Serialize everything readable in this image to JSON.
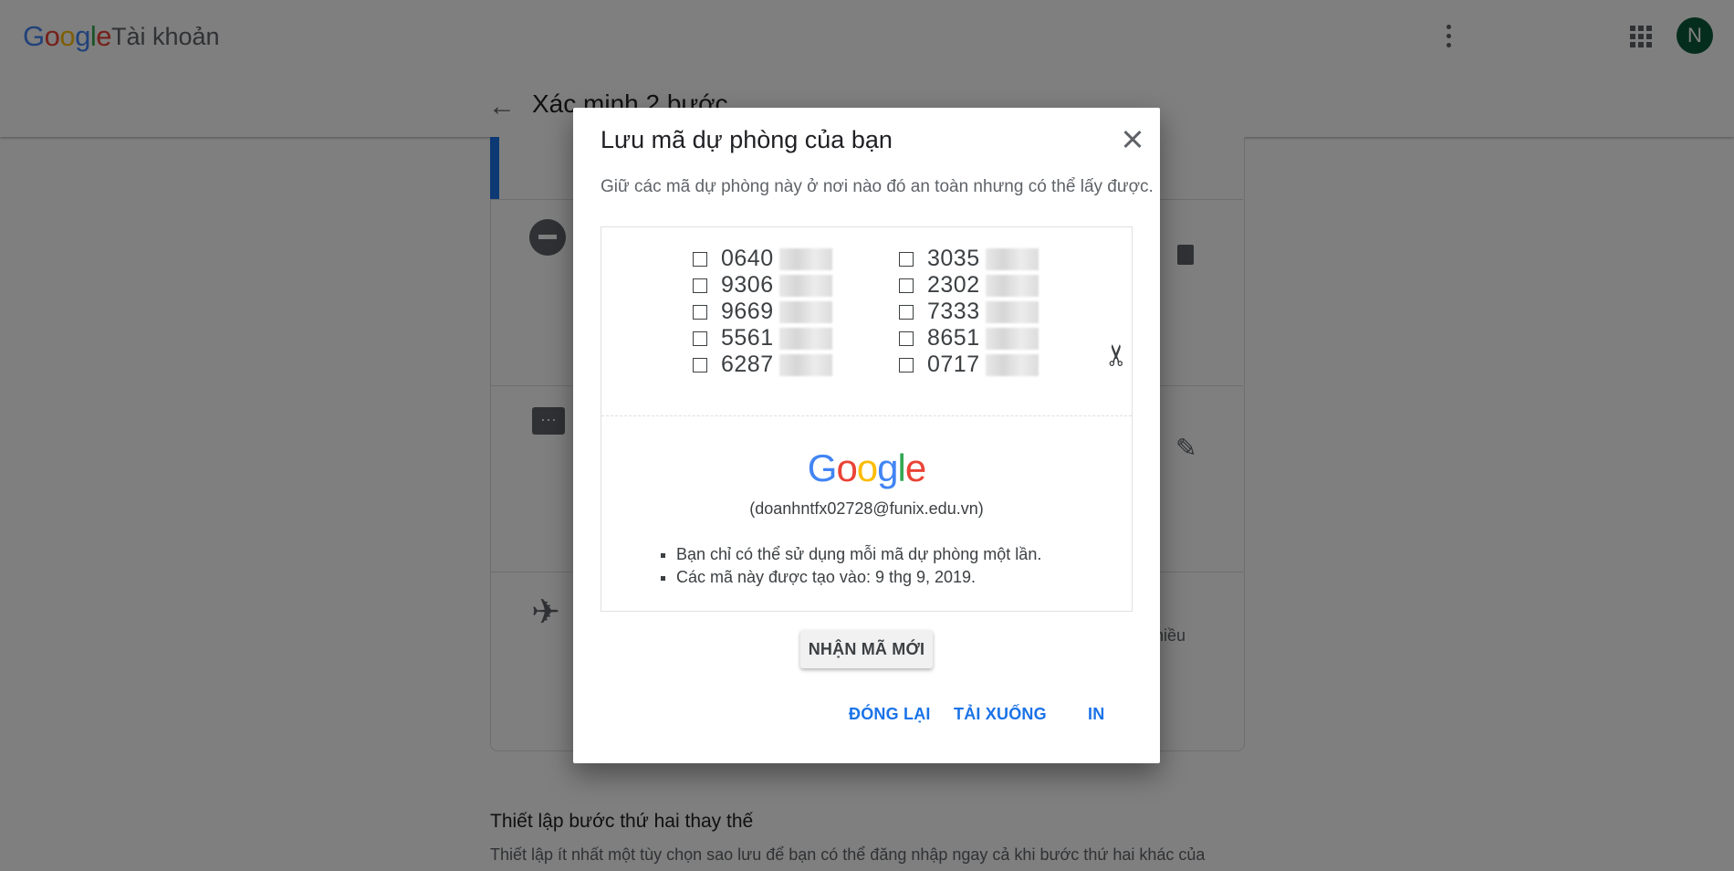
{
  "header": {
    "logo_letters": [
      "G",
      "o",
      "o",
      "g",
      "l",
      "e"
    ],
    "product_name": "Tài khoản",
    "avatar_letter": "N",
    "page_title": "Xác minh 2 bước"
  },
  "background": {
    "side_text": "hiều",
    "section_title": "Thiết lập bước thứ hai thay thế",
    "section_desc": "Thiết lập ít nhất một tùy chọn sao lưu để bạn có thể đăng nhập ngay cả khi bước thứ hai khác của"
  },
  "dialog": {
    "title": "Lưu mã dự phòng của bạn",
    "subtitle": "Giữ các mã dự phòng này ở nơi nào đó an toàn nhưng có thể lấy được.",
    "codes_left": [
      "0640",
      "9306",
      "9669",
      "5561",
      "6287"
    ],
    "codes_right": [
      "3035",
      "2302",
      "7333",
      "8651",
      "0717"
    ],
    "logo_letters": [
      "G",
      "o",
      "o",
      "g",
      "l",
      "e"
    ],
    "account_email": "(doanhntfx02728@funix.edu.vn)",
    "notes": [
      "Bạn chỉ có thể sử dụng mỗi mã dự phòng một lần.",
      "Các mã này được tạo vào: 9 thg 9, 2019."
    ],
    "new_codes_label": "NHẬN MÃ MỚI",
    "close_label": "ĐÓNG LẠI",
    "download_label": "TẢI XUỐNG",
    "print_label": "IN"
  },
  "colors": {
    "accent": "#1a73e8",
    "avatar_bg": "#0b5a3a",
    "scrim": "rgba(0,0,0,0.5)"
  },
  "icons": [
    "back-arrow-icon",
    "more-vert-icon",
    "apps-grid-icon",
    "close-icon",
    "scissors-icon",
    "trash-icon",
    "pencil-icon",
    "message-icon",
    "airplane-icon"
  ]
}
